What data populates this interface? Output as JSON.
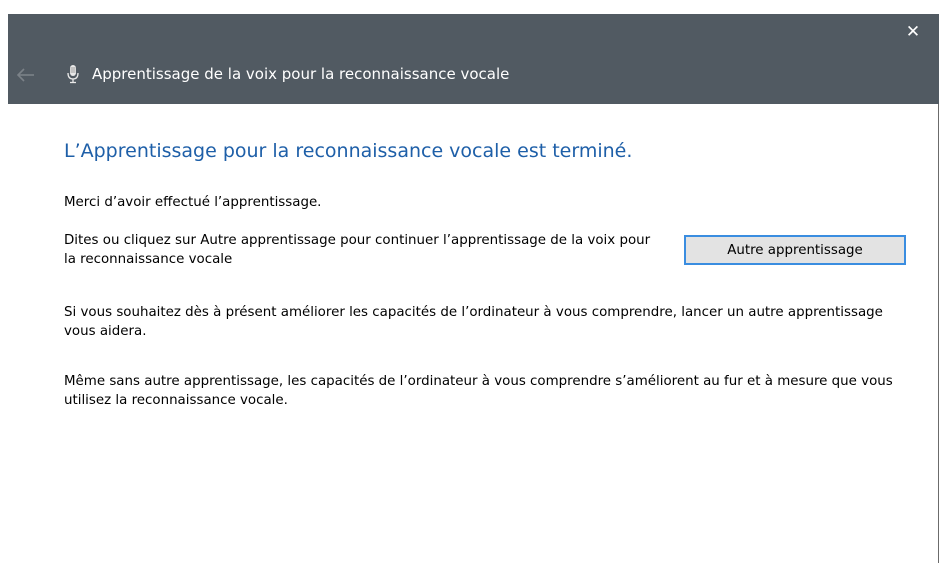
{
  "window": {
    "title": "Apprentissage de la voix pour la reconnaissance vocale",
    "close_glyph": "✕"
  },
  "main": {
    "heading": "L’Apprentissage pour la reconnaissance vocale est terminé.",
    "paragraphs": [
      "Merci d’avoir effectué l’apprentissage.",
      "Dites ou cliquez sur Autre apprentissage pour continuer l’apprentissage de la voix pour la reconnaissance vocale",
      "Si vous souhaitez dès à présent améliorer les capacités de l’ordinateur à vous comprendre, lancer un autre apprentissage vous aidera.",
      "Même sans autre apprentissage, les capacités de l’ordinateur à vous comprendre s’améliorent au fur et à mesure que vous utilisez la reconnaissance vocale."
    ],
    "train_button_label": "Autre apprentissage"
  },
  "icons": {
    "back": "back-arrow-icon",
    "mic": "microphone-icon",
    "close": "close-icon"
  },
  "colors": {
    "titlebar": "#515a62",
    "heading": "#1e5fa8",
    "button_border": "#3a8de0",
    "button_bg": "#e3e3e3"
  }
}
